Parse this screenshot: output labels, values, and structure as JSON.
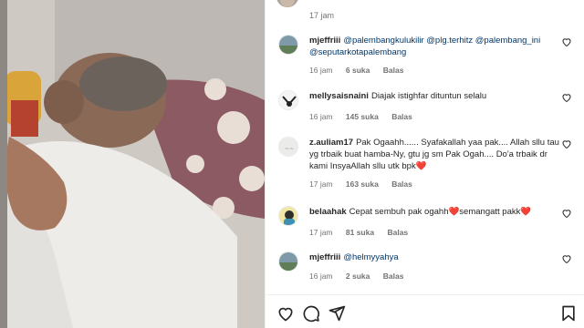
{
  "post": {
    "top_timestamp": "17 jam"
  },
  "comments": [
    {
      "username": "mjeffriii",
      "parts": [
        {
          "t": "@palembangkulukilir",
          "m": true
        },
        {
          "t": " ",
          "m": false
        },
        {
          "t": "@plg.terhitz",
          "m": true
        },
        {
          "t": " ",
          "m": false
        },
        {
          "t": "@palembang_ini",
          "m": true
        },
        {
          "t": " ",
          "m": false
        },
        {
          "t": "@seputarkotapalembang",
          "m": true
        }
      ],
      "time": "16 jam",
      "likes": "6 suka",
      "reply": "Balas"
    },
    {
      "username": "mellysaisnaini",
      "parts": [
        {
          "t": "Diajak istighfar dituntun selalu",
          "m": false
        }
      ],
      "time": "16 jam",
      "likes": "145 suka",
      "reply": "Balas"
    },
    {
      "username": "z.auliam17",
      "parts": [
        {
          "t": "Pak Ogaahh...... Syafakallah yaa pak.... Allah sllu tau yg trbaik buat hamba-Ny, gtu jg sm Pak Ogah.... Do'a trbaik dr kami InsyaAllah sllu utk bpk❤️",
          "m": false
        }
      ],
      "time": "17 jam",
      "likes": "163 suka",
      "reply": "Balas"
    },
    {
      "username": "belaahak",
      "parts": [
        {
          "t": "Cepat sembuh pak ogahh❤️semangatt pakk❤️",
          "m": false
        }
      ],
      "time": "17 jam",
      "likes": "81 suka",
      "reply": "Balas"
    },
    {
      "username": "mjeffriii",
      "parts": [
        {
          "t": "@helmyyahya",
          "m": true
        }
      ],
      "time": "16 jam",
      "likes": "2 suka",
      "reply": "Balas"
    }
  ],
  "icons": {
    "like": "heart-icon",
    "comment": "comment-icon",
    "share": "send-icon",
    "save": "bookmark-icon"
  },
  "colors": {
    "mention": "#00376b",
    "meta": "#737373",
    "text": "#262626"
  }
}
